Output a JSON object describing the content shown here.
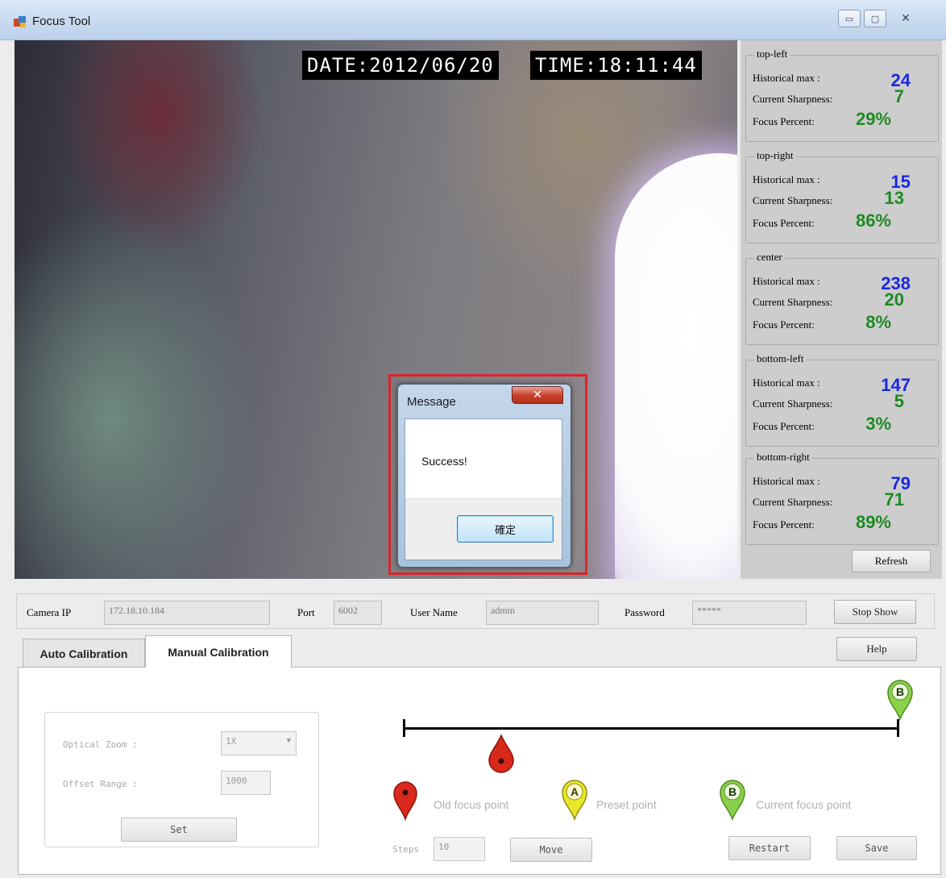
{
  "window": {
    "title": "Focus Tool",
    "minimize_glyph": "▭",
    "maximize_glyph": "▢",
    "close_glyph": "✕"
  },
  "video": {
    "date": "DATE:2012/06/20",
    "time": "TIME:18:11:44"
  },
  "dialog": {
    "title": "Message",
    "close_glyph": "✕",
    "message": "Success!",
    "ok_label": "確定"
  },
  "metrics": {
    "historical_label": "Historical max :",
    "sharpness_label": "Current Sharpness:",
    "percent_label": "Focus Percent:",
    "regions": [
      {
        "name": "top-left",
        "historical_max": "24",
        "current_sharpness": "7",
        "focus_percent": "29%"
      },
      {
        "name": "top-right",
        "historical_max": "15",
        "current_sharpness": "13",
        "focus_percent": "86%"
      },
      {
        "name": "center",
        "historical_max": "238",
        "current_sharpness": "20",
        "focus_percent": "8%"
      },
      {
        "name": "bottom-left",
        "historical_max": "147",
        "current_sharpness": "5",
        "focus_percent": "3%"
      },
      {
        "name": "bottom-right",
        "historical_max": "79",
        "current_sharpness": "71",
        "focus_percent": "89%"
      }
    ],
    "refresh_label": "Refresh"
  },
  "connection": {
    "camera_ip_label": "Camera IP",
    "camera_ip": "172.18.10.184",
    "port_label": "Port",
    "port": "6002",
    "username_label": "User Name",
    "username": "admin",
    "password_label": "Password",
    "password": "*****",
    "stop_show_label": "Stop Show"
  },
  "tabs": [
    {
      "label": "Auto Calibration",
      "active": false
    },
    {
      "label": "Manual Calibration",
      "active": true
    }
  ],
  "help_label": "Help",
  "manual": {
    "optical_zoom_label": "Optical Zoom :",
    "optical_zoom_value": "1X",
    "offset_range_label": "Offset Range :",
    "offset_range_value": "1000",
    "set_label": "Set",
    "steps_label": "Steps",
    "steps_value": "10",
    "move_label": "Move",
    "restart_label": "Restart",
    "save_label": "Save",
    "legend_old": "Old focus point",
    "legend_preset": "Preset point",
    "legend_current": "Current focus point",
    "pin_a_letter": "A",
    "pin_b_letter": "B",
    "colors": {
      "old": "#d8291c",
      "preset": "#e8e62a",
      "current": "#8bd04a"
    }
  }
}
